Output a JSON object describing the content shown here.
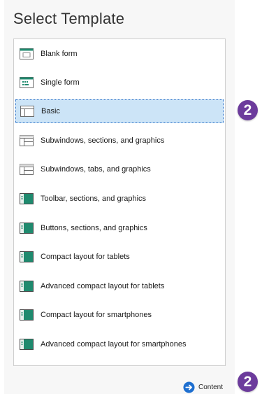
{
  "dialog": {
    "title": "Select Template",
    "templates": [
      {
        "label": "Blank form",
        "icon": "blank-form-icon",
        "selected": false
      },
      {
        "label": "Single form",
        "icon": "single-form-icon",
        "selected": false
      },
      {
        "label": "Basic",
        "icon": "basic-layout-icon",
        "selected": true
      },
      {
        "label": "Subwindows, sections, and graphics",
        "icon": "subwindows-layout-icon",
        "selected": false
      },
      {
        "label": "Subwindows, tabs, and graphics",
        "icon": "subwindows-layout-icon",
        "selected": false
      },
      {
        "label": "Toolbar, sections, and graphics",
        "icon": "sidebar-layout-icon",
        "selected": false
      },
      {
        "label": "Buttons, sections, and graphics",
        "icon": "sidebar-layout-icon",
        "selected": false
      },
      {
        "label": "Compact layout for tablets",
        "icon": "sidebar-layout-icon",
        "selected": false
      },
      {
        "label": "Advanced compact layout for tablets",
        "icon": "sidebar-layout-icon",
        "selected": false
      },
      {
        "label": "Compact layout for smartphones",
        "icon": "sidebar-layout-icon",
        "selected": false
      },
      {
        "label": "Advanced compact layout for smartphones",
        "icon": "sidebar-layout-icon",
        "selected": false
      }
    ],
    "next_button": {
      "label": "Content",
      "icon": "arrow-right-circle-icon"
    }
  },
  "callouts": [
    {
      "text": "2"
    },
    {
      "text": "2"
    }
  ],
  "colors": {
    "selection": "#cce4f7",
    "selection_border": "#2a70c8",
    "badge": "#6c3b9c",
    "icon_green": "#1f8a6e",
    "next_arrow": "#1e6fd0"
  }
}
